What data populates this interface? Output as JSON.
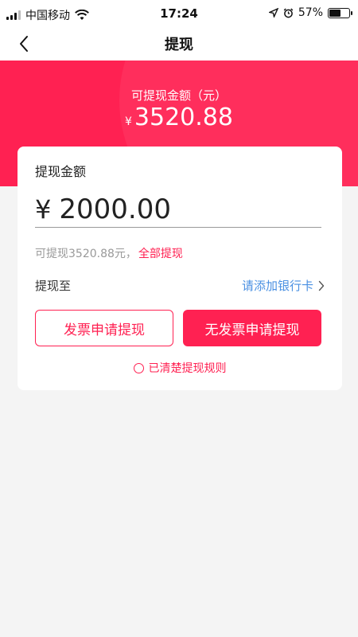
{
  "status_bar": {
    "carrier": "中国移动",
    "time": "17:24",
    "battery": "57%"
  },
  "nav": {
    "title": "提现"
  },
  "header": {
    "label": "可提现金额（元）",
    "currency": "¥",
    "amount": "3520.88"
  },
  "card": {
    "title": "提现金额",
    "currency": "¥",
    "amount_value": "2000.00",
    "available_text": "可提现3520.88元，",
    "withdraw_all_label": "全部提现",
    "withdraw_to_label": "提现至",
    "add_bank_label": "请添加银行卡",
    "invoice_button": "发票申请提现",
    "no_invoice_button": "无发票申请提现",
    "rules_text": "已清楚提现规则"
  },
  "colors": {
    "accent": "#ff2152",
    "link": "#4a90e2",
    "background": "#f4f4f4"
  }
}
